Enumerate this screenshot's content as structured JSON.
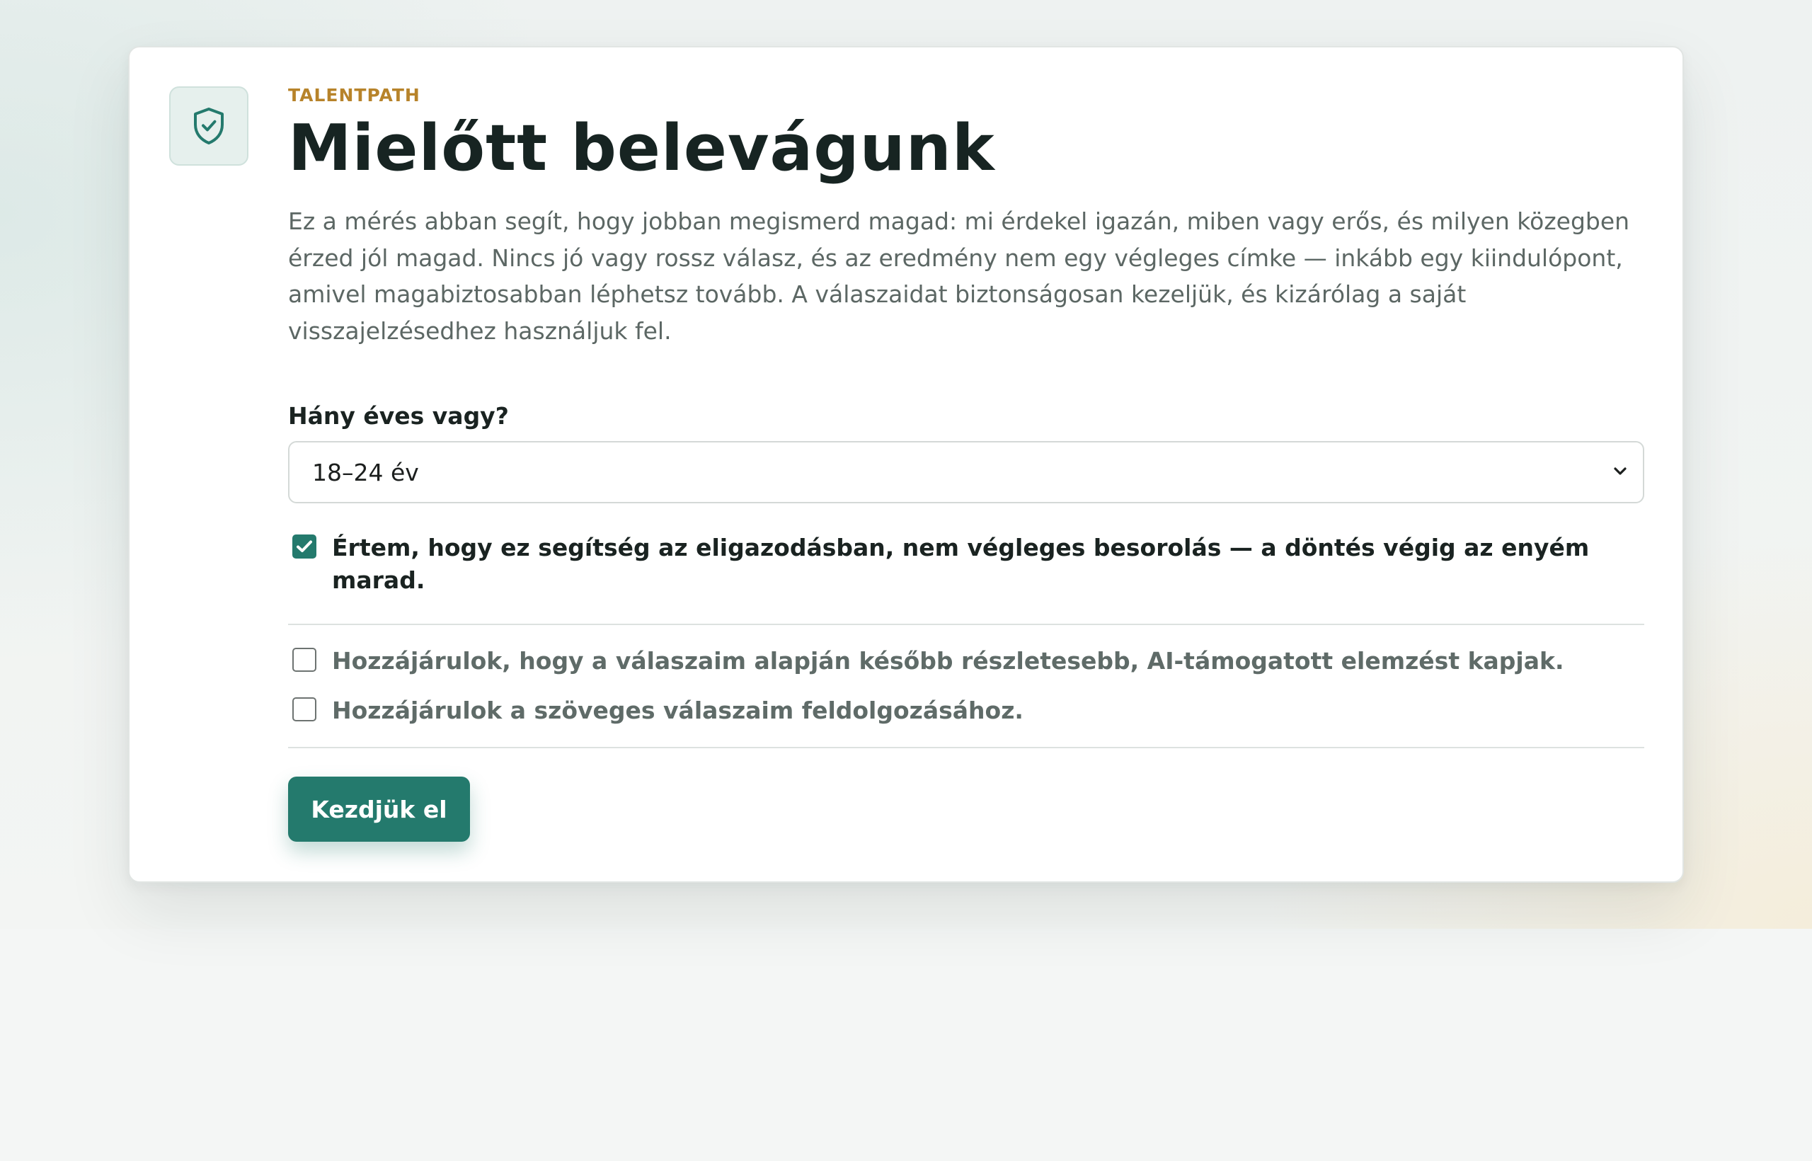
{
  "brand": "TALENTPATH",
  "title": "Mielőtt belevágunk",
  "intro": "Ez a mérés abban segít, hogy jobban megismerd magad: mi érdekel igazán, miben vagy erős, és milyen közegben érzed jól magad. Nincs jó vagy rossz válasz, és az eredmény nem egy végleges címke — inkább egy kiindulópont, amivel magabiztosabban léphetsz tovább. A válaszaidat biztonságosan kezeljük, és kizárólag a saját visszajelzésedhez használjuk fel.",
  "age": {
    "label": "Hány éves vagy?",
    "selected": "18–24 év"
  },
  "consents": [
    {
      "text": "Értem, hogy ez segítség az eligazodásban, nem végleges besorolás — a döntés végig az enyém marad.",
      "checked": true
    },
    {
      "text": "Hozzájárulok, hogy a válaszaim alapján később részletesebb, AI-támogatott elemzést kapjak.",
      "checked": false
    },
    {
      "text": "Hozzájárulok a szöveges válaszaim feldolgozásához.",
      "checked": false
    }
  ],
  "start_label": "Kezdjük el",
  "colors": {
    "accent": "#247a6d",
    "brand": "#b7832a",
    "heading": "#172422",
    "body_text": "#5c6764"
  },
  "icons": {
    "header": "shield-check-icon",
    "select": "chevron-down-icon",
    "checkbox_on": "checkmark-icon"
  }
}
